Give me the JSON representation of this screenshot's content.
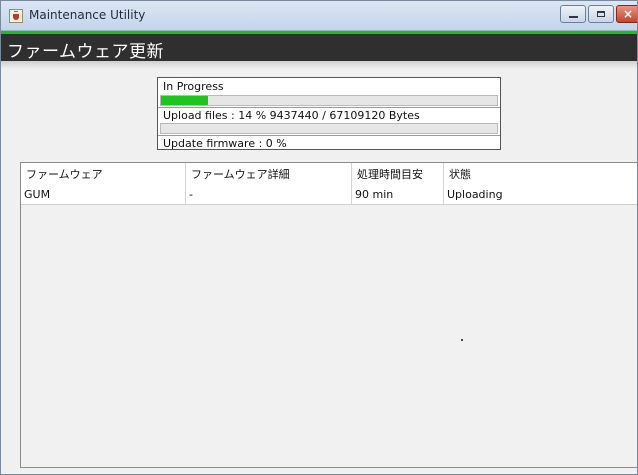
{
  "window": {
    "title": "Maintenance Utility",
    "icon": "java-cup-icon",
    "controls": {
      "minimize": "minimize-icon",
      "maximize": "maximize-icon",
      "close": "×"
    }
  },
  "header": {
    "title": "ファームウェア更新",
    "accent_color": "#19c11e",
    "background": "#2f2f2f"
  },
  "progress": {
    "status_label": "In Progress",
    "upload_label": "Upload files : 14 % 9437440 / 67109120 Bytes",
    "upload_percent": 14,
    "update_label": "Update firmware : 0 %",
    "update_percent": 0
  },
  "table": {
    "columns": [
      "ファームウェア",
      "ファームウェア詳細",
      "処理時間目安",
      "状態"
    ],
    "rows": [
      [
        "GUM",
        "-",
        "90 min",
        "Uploading"
      ]
    ]
  }
}
